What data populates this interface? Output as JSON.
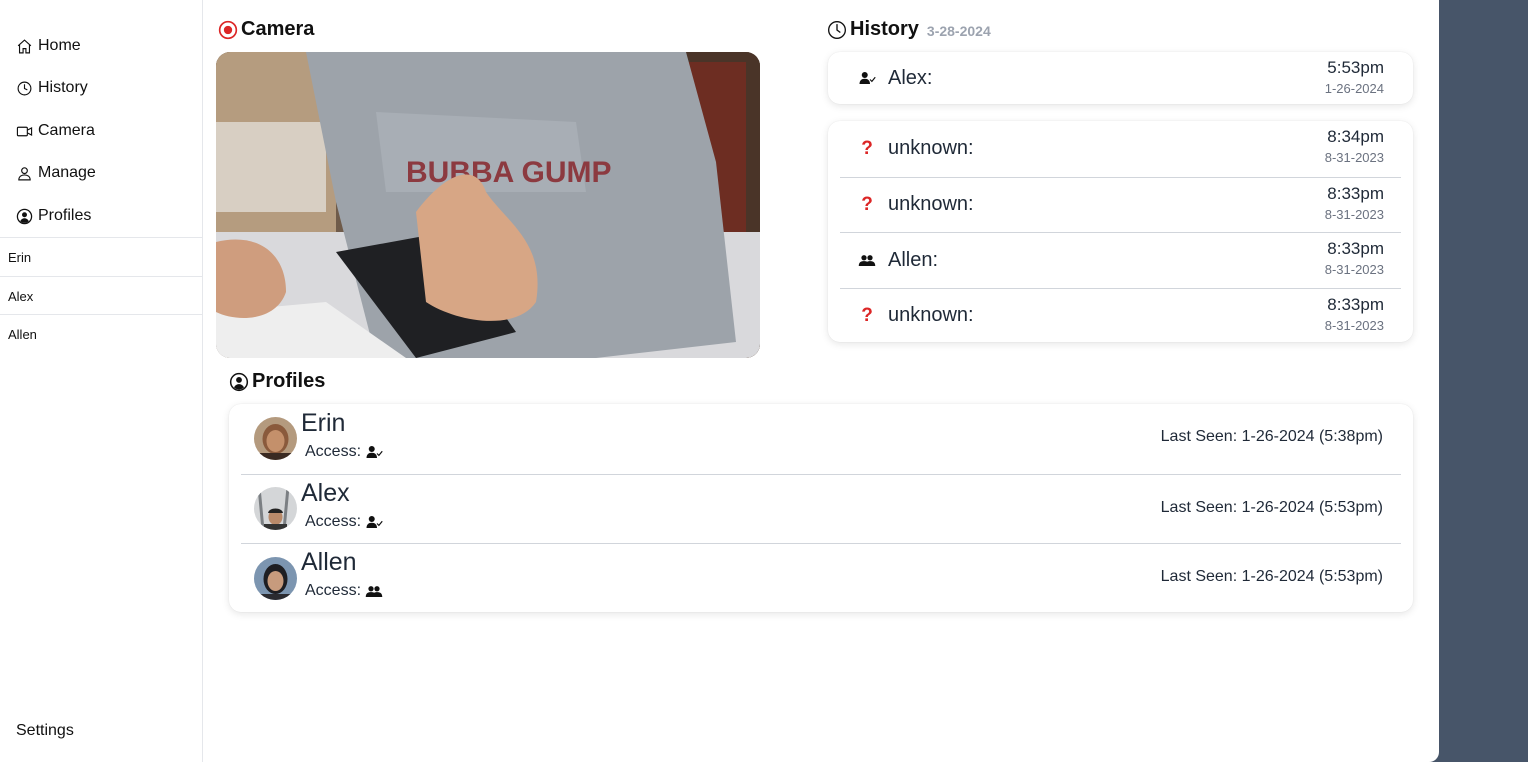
{
  "sidebar": {
    "nav": [
      {
        "label": "Home",
        "icon": "home-icon"
      },
      {
        "label": "History",
        "icon": "clock-icon"
      },
      {
        "label": "Camera",
        "icon": "video-icon"
      },
      {
        "label": "Manage",
        "icon": "user-icon"
      },
      {
        "label": "Profiles",
        "icon": "user-circle-icon"
      }
    ],
    "profiles": [
      "Erin",
      "Alex",
      "Allen"
    ],
    "settings_label": "Settings"
  },
  "camera": {
    "title": "Camera",
    "icon": "record-icon",
    "accent": "#dc2626"
  },
  "history": {
    "title": "History",
    "date": "3-28-2024",
    "latest": {
      "name": "Alex:",
      "time": "5:53pm",
      "date": "1-26-2024",
      "icon": "user-check-icon"
    },
    "entries": [
      {
        "name": "unknown:",
        "time": "8:34pm",
        "date": "8-31-2023",
        "icon": "question-icon"
      },
      {
        "name": "unknown:",
        "time": "8:33pm",
        "date": "8-31-2023",
        "icon": "question-icon"
      },
      {
        "name": "Allen:",
        "time": "8:33pm",
        "date": "8-31-2023",
        "icon": "users-icon"
      },
      {
        "name": "unknown:",
        "time": "8:33pm",
        "date": "8-31-2023",
        "icon": "question-icon"
      }
    ]
  },
  "profiles": {
    "title": "Profiles",
    "access_label": "Access:",
    "items": [
      {
        "name": "Erin",
        "access_icon": "user-check-icon",
        "last_seen": "Last Seen: 1-26-2024 (5:38pm)"
      },
      {
        "name": "Alex",
        "access_icon": "user-check-icon",
        "last_seen": "Last Seen: 1-26-2024 (5:53pm)"
      },
      {
        "name": "Allen",
        "access_icon": "users-icon",
        "last_seen": "Last Seen: 1-26-2024 (5:53pm)"
      }
    ]
  },
  "colors": {
    "frame": "#475569",
    "unknown": "#dc2626"
  }
}
